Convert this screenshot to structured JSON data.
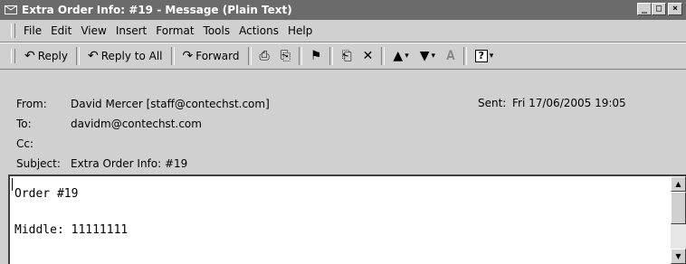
{
  "window": {
    "title": "Extra Order Info: #19 - Message (Plain Text)",
    "minimize": "_",
    "maximize": "□",
    "close": "×"
  },
  "menu": [
    "File",
    "Edit",
    "View",
    "Insert",
    "Format",
    "Tools",
    "Actions",
    "Help"
  ],
  "toolbar": {
    "reply_label": "Reply",
    "reply_all_label": "Reply to All",
    "forward_label": "Forward",
    "help_glyph": "?"
  },
  "headers": {
    "from_label": "From:",
    "from_value": "David Mercer [staff@contechst.com]",
    "sent_label": "Sent:",
    "sent_value": "Fri 17/06/2005 19:05",
    "to_label": "To:",
    "to_value": "davidm@contechst.com",
    "cc_label": "Cc:",
    "cc_value": "",
    "subject_label": "Subject:",
    "subject_value": "Extra Order Info: #19"
  },
  "body": {
    "lines": [
      "Order #19",
      "Middle: 11111111"
    ]
  }
}
